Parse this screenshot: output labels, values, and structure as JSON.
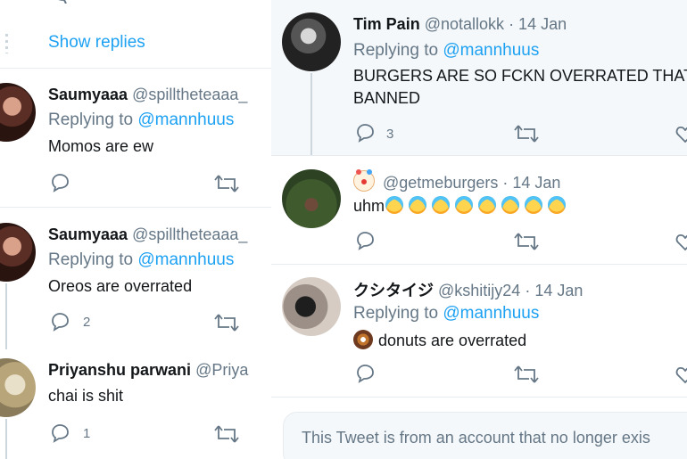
{
  "left": {
    "show_replies": "Show replies",
    "tweets": [
      {
        "name": "Saumyaaa",
        "handle": "@spilltheteaaa_",
        "replying_label": "Replying to",
        "replying_to": "@mannhuus",
        "text": "Momos are ew"
      },
      {
        "name": "Saumyaaa",
        "handle": "@spilltheteaaa_",
        "replying_label": "Replying to",
        "replying_to": "@mannhuus",
        "text": "Oreos are overrated",
        "reply_count": "2"
      },
      {
        "name": "Priyanshu parwani",
        "handle": "@Priya",
        "text": "chai is shit",
        "reply_count": "1"
      }
    ]
  },
  "right": {
    "tweets": [
      {
        "name": "Tim Pain",
        "handle": "@notallokk",
        "date": "· 14 Jan",
        "replying_label": "Replying to",
        "replying_to": "@mannhuus",
        "text_line1": "BURGERS ARE SO FCKN OVERRATED THAT",
        "text_line2": "BANNED",
        "reply_count": "3"
      },
      {
        "name_emoji": "clown-face-emoji",
        "handle": "@getmeburgers",
        "date": "· 14 Jan",
        "text": "uhm",
        "emoji_count": 8
      },
      {
        "name": "クシタイジ",
        "handle": "@kshitijy24",
        "date": "· 14 Jan",
        "replying_label": "Replying to",
        "replying_to": "@mannhuus",
        "text": "donuts are overrated"
      }
    ],
    "unavailable_notice": "This Tweet is from an account that no longer exis"
  },
  "colors": {
    "accent": "#1da1f2",
    "muted": "#657786",
    "divider": "#e6ecf0"
  }
}
